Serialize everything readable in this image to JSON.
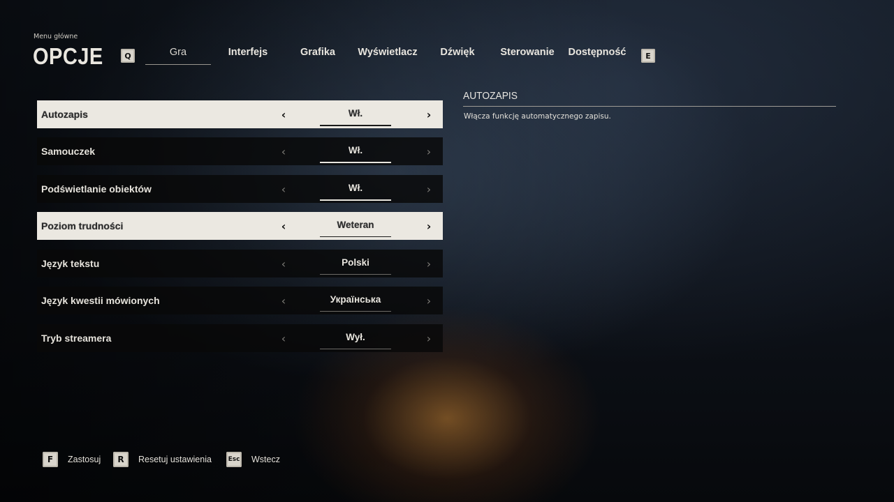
{
  "header": {
    "breadcrumb": "Menu główne",
    "title": "OPCJE",
    "prev_key": "Q",
    "next_key": "E"
  },
  "tabs": [
    {
      "label": "Gra",
      "active": true
    },
    {
      "label": "Interfejs",
      "active": false
    },
    {
      "label": "Grafika",
      "active": false
    },
    {
      "label": "Wyświetlacz",
      "active": false
    },
    {
      "label": "Dźwięk",
      "active": false
    },
    {
      "label": "Sterowanie",
      "active": false
    },
    {
      "label": "Dostępność",
      "active": false
    }
  ],
  "settings": [
    {
      "label": "Autozapis",
      "value": "Wł.",
      "highlighted": true
    },
    {
      "label": "Samouczek",
      "value": "Wł.",
      "highlighted": false
    },
    {
      "label": "Podświetlanie obiektów",
      "value": "Wł.",
      "highlighted": false
    },
    {
      "label": "Poziom trudności",
      "value": "Weteran",
      "highlighted": true
    },
    {
      "label": "Język tekstu",
      "value": "Polski",
      "highlighted": false
    },
    {
      "label": "Język kwestii mówionych",
      "value": "Українська",
      "highlighted": false
    },
    {
      "label": "Tryb streamera",
      "value": "Wył.",
      "highlighted": false
    }
  ],
  "description": {
    "title": "AUTOZAPIS",
    "text": "Włącza funkcję automatycznego zapisu."
  },
  "footer": {
    "apply_key": "F",
    "apply_label": "Zastosuj",
    "reset_key": "R",
    "reset_label": "Resetuj ustawienia",
    "back_key": "Esc",
    "back_label": "Wstecz"
  },
  "icons": {
    "arrow_left": "‹",
    "arrow_right": "›"
  },
  "colors": {
    "highlight_row": "#ebe8e1",
    "row_bg": "#080809",
    "key_cap": "#d9d5cc"
  }
}
